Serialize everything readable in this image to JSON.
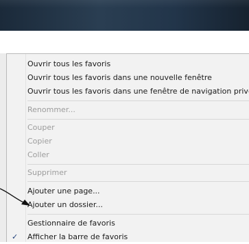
{
  "menu": {
    "items": [
      {
        "label": "Ouvrir tous les favoris",
        "enabled": true
      },
      {
        "label": "Ouvrir tous les favoris dans une nouvelle fenêtre",
        "enabled": true
      },
      {
        "label": "Ouvrir tous les favoris dans une fenêtre de navigation privée",
        "enabled": true
      },
      {
        "label": "Renommer...",
        "enabled": false
      },
      {
        "label": "Couper",
        "enabled": false
      },
      {
        "label": "Copier",
        "enabled": false
      },
      {
        "label": "Coller",
        "enabled": false
      },
      {
        "label": "Supprimer",
        "enabled": false
      },
      {
        "label": "Ajouter une page...",
        "enabled": true
      },
      {
        "label": "Ajouter un dossier...",
        "enabled": true
      },
      {
        "label": "Gestionnaire de favoris",
        "enabled": true
      },
      {
        "label": "Afficher la barre de favoris",
        "enabled": true,
        "checked": true,
        "check_glyph": "✓"
      }
    ]
  }
}
